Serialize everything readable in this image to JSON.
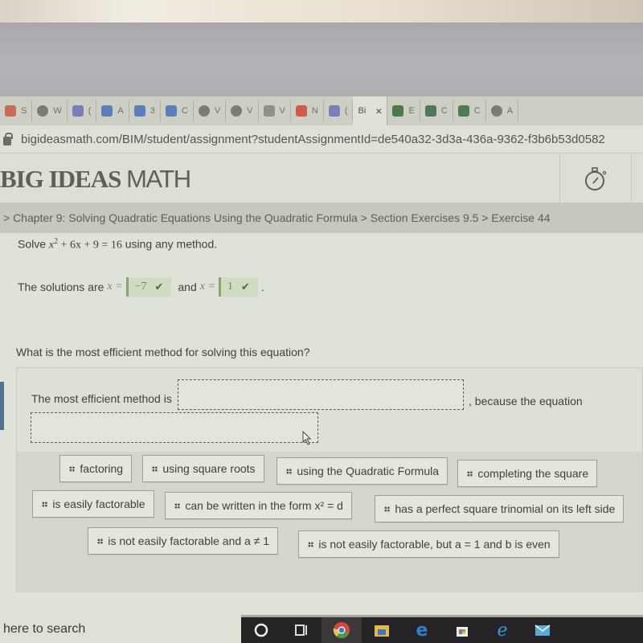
{
  "browser": {
    "tabs": [
      {
        "label": "S",
        "icon": "generic-icon",
        "color": "#c96b5a"
      },
      {
        "label": "W",
        "icon": "globe-icon",
        "color": "#7a7c74"
      },
      {
        "label": "(",
        "icon": "teams-icon",
        "color": "#7b7fb5"
      },
      {
        "label": "A",
        "icon": "word-icon",
        "color": "#5a7fb8"
      },
      {
        "label": "3",
        "icon": "word-icon",
        "color": "#5a7fb8"
      },
      {
        "label": "C",
        "icon": "word-icon",
        "color": "#5a7fb8"
      },
      {
        "label": "V",
        "icon": "globe-icon",
        "color": "#7a7c74"
      },
      {
        "label": "V",
        "icon": "globe-icon",
        "color": "#7a7c74"
      },
      {
        "label": "V",
        "icon": "video-icon",
        "color": "#8e9187"
      },
      {
        "label": "N",
        "icon": "office-icon",
        "color": "#d25a4a"
      },
      {
        "label": "(",
        "icon": "teams-icon",
        "color": "#7b7fb5"
      },
      {
        "label": "Bi",
        "icon": "none",
        "color": "#e0e2d8",
        "active": true,
        "close": "×"
      },
      {
        "label": "E",
        "icon": "book-icon",
        "color": "#4c7a4c"
      },
      {
        "label": "C",
        "icon": "diamond-icon",
        "color": "#4f7a58"
      },
      {
        "label": "C",
        "icon": "diamond-icon",
        "color": "#4f7a58"
      },
      {
        "label": "A",
        "icon": "globe-icon",
        "color": "#7a7c74"
      }
    ],
    "url": "bigideasmath.com/BIM/student/assignment?studentAssignmentId=de540a32-3d3a-436a-9362-f3b6b53d0582"
  },
  "header": {
    "logo_bold": "BIG IDEAS",
    "logo_thin": "MATH",
    "timer_icon": "stopwatch-icon"
  },
  "breadcrumb": {
    "text": "> Chapter 9: Solving Quadratic Equations Using the Quadratic Formula > Section Exercises 9.5 > Exercise 44"
  },
  "question1": {
    "prefix": "Solve ",
    "equation_var": "x",
    "equation_exp": "2",
    "equation_rest": " + 6x + 9 = 16",
    "suffix": " using any method.",
    "solutions_label": "The solutions are ",
    "var_eq": "x =",
    "answer1": "−7",
    "and_label": "and",
    "answer2": "1",
    "period": ".",
    "check_glyph": "✔"
  },
  "question2": {
    "prompt": "What is the most efficient method for solving this equation?",
    "sentence_start": "The most efficient method is",
    "because": ", because the equation",
    "slot1_value": "",
    "slot2_value": ""
  },
  "bank": {
    "grip": "⠶",
    "row1": [
      "factoring",
      "using square roots",
      "using the Quadratic Formula",
      "completing the square"
    ],
    "row2": [
      "is easily factorable",
      "can be written in the form x² = d",
      "has a perfect square trinomial on its left side"
    ],
    "row3": [
      "is not easily factorable and a ≠ 1",
      "is not easily factorable, but a = 1 and b is even"
    ]
  },
  "taskbar": {
    "search_text": "here to search",
    "icons": [
      "cortana-icon",
      "task-view-icon",
      "chrome-icon",
      "file-explorer-icon",
      "edge-icon",
      "store-icon",
      "ie-icon",
      "mail-icon"
    ]
  }
}
